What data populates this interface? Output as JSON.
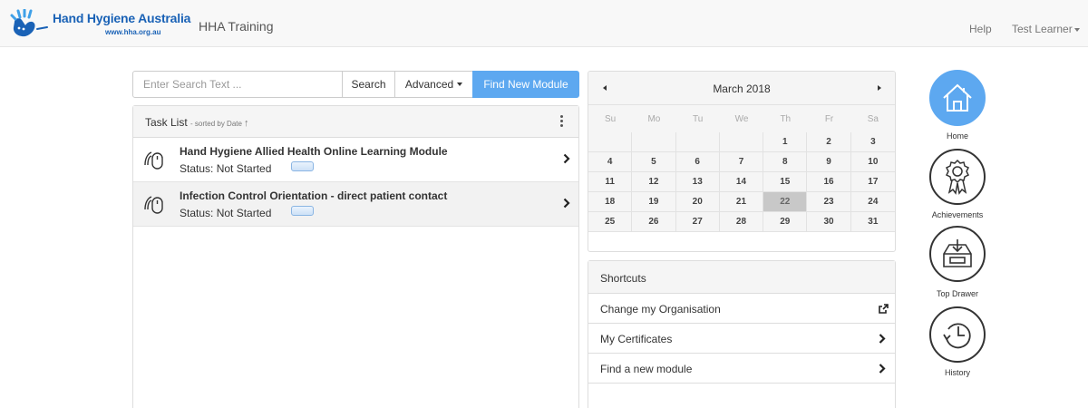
{
  "navbar": {
    "logo_title": "Hand Hygiene Australia",
    "logo_url": "www.hha.org.au",
    "app_name": "HHA Training",
    "help_label": "Help",
    "user_label": "Test Learner"
  },
  "search": {
    "placeholder": "Enter Search Text ...",
    "search_label": "Search",
    "advanced_label": "Advanced",
    "find_label": "Find New Module"
  },
  "task_list": {
    "title": "Task List",
    "sort_text": "- sorted by Date",
    "sort_arrow": "↑",
    "items": [
      {
        "name": "Hand Hygiene Allied Health Online Learning Module",
        "status": "Status: Not Started"
      },
      {
        "name": "Infection Control Orientation - direct patient contact",
        "status": "Status: Not Started"
      }
    ]
  },
  "calendar": {
    "month": "March 2018",
    "weekdays": [
      "Su",
      "Mo",
      "Tu",
      "We",
      "Th",
      "Fr",
      "Sa"
    ],
    "weeks": [
      [
        "",
        "",
        "",
        "",
        "1",
        "2",
        "3"
      ],
      [
        "4",
        "5",
        "6",
        "7",
        "8",
        "9",
        "10"
      ],
      [
        "11",
        "12",
        "13",
        "14",
        "15",
        "16",
        "17"
      ],
      [
        "18",
        "19",
        "20",
        "21",
        "22",
        "23",
        "24"
      ],
      [
        "25",
        "26",
        "27",
        "28",
        "29",
        "30",
        "31"
      ]
    ],
    "today": "22"
  },
  "shortcuts": {
    "title": "Shortcuts",
    "items": [
      {
        "label": "Change my Organisation",
        "icon": "external-link-icon"
      },
      {
        "label": "My Certificates",
        "icon": "chevron-right-icon"
      },
      {
        "label": "Find a new module",
        "icon": "chevron-right-icon"
      }
    ]
  },
  "side_nav": [
    {
      "label": "Home",
      "icon": "home-icon",
      "active": true
    },
    {
      "label": "Achievements",
      "icon": "award-ribbon-icon",
      "active": false
    },
    {
      "label": "Top Drawer",
      "icon": "inbox-drawer-icon",
      "active": false
    },
    {
      "label": "History",
      "icon": "history-clock-icon",
      "active": false
    }
  ],
  "colors": {
    "accent": "#5da8f0",
    "brand": "#1a62b6"
  }
}
